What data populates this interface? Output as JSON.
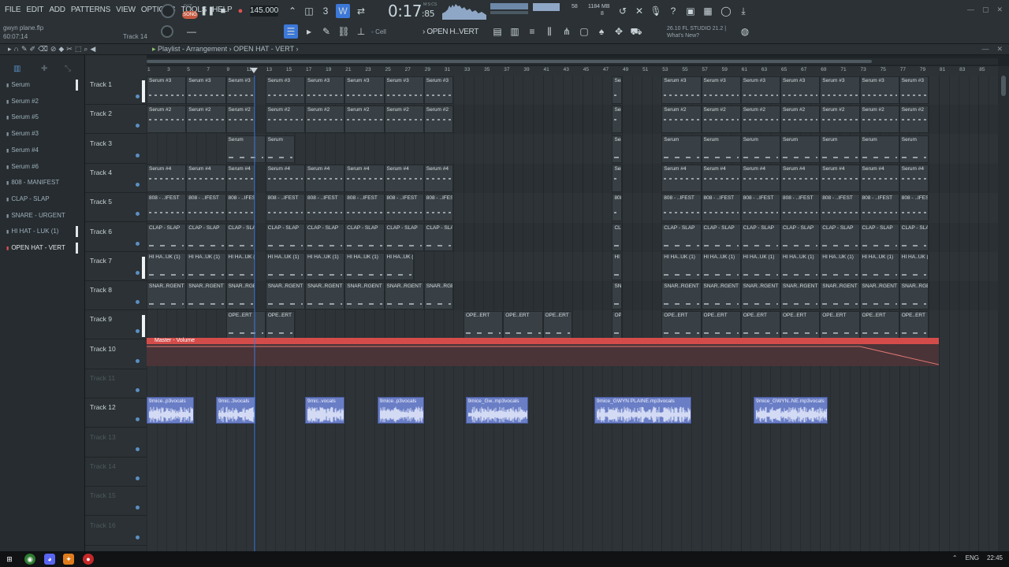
{
  "menu": [
    "FILE",
    "EDIT",
    "ADD",
    "PATTERNS",
    "VIEW",
    "OPTIONS",
    "TOOLS",
    "HELP"
  ],
  "project": {
    "name": "gwyn plane.flp",
    "time": "60:07:14",
    "track_hint": "Track 14"
  },
  "transport": {
    "pat_label": "PAT",
    "song_label": "SONG",
    "tempo": "145.000",
    "clock_main": "0:17",
    "clock_sub": ":85",
    "clock_unit": "M:S:CS"
  },
  "perf": {
    "ram": "1184 MB",
    "poly": "58",
    "poly2": "8"
  },
  "snap": {
    "label": "Cell"
  },
  "pattern_selector": {
    "name": "OPEN H..VERT"
  },
  "version": {
    "line1": "26.10 FL STUDIO 21.2 |",
    "line2": "What's New?"
  },
  "playlist": {
    "title": "Playlist - Arrangement",
    "pattern": "OPEN HAT - VERT",
    "sep": "›"
  },
  "patterns": [
    {
      "label": "Serum",
      "active": false,
      "selected": true
    },
    {
      "label": "Serum #2",
      "active": false,
      "selected": false
    },
    {
      "label": "Serum #5",
      "active": false,
      "selected": false
    },
    {
      "label": "Serum #3",
      "active": false,
      "selected": false
    },
    {
      "label": "Serum #4",
      "active": false,
      "selected": false
    },
    {
      "label": "Serum #6",
      "active": false,
      "selected": false
    },
    {
      "label": "808 - MANIFEST",
      "active": false,
      "selected": false
    },
    {
      "label": "CLAP - SLAP",
      "active": false,
      "selected": false
    },
    {
      "label": "SNARE - URGENT",
      "active": false,
      "selected": false
    },
    {
      "label": "HI HAT - LUK (1)",
      "active": false,
      "selected": true
    },
    {
      "label": "OPEN HAT - VERT",
      "active": true,
      "selected": true
    }
  ],
  "tracks": [
    {
      "name": "Track 1",
      "dim": false,
      "bar": true
    },
    {
      "name": "Track 2",
      "dim": false,
      "bar": false
    },
    {
      "name": "Track 3",
      "dim": false,
      "bar": false
    },
    {
      "name": "Track 4",
      "dim": false,
      "bar": false
    },
    {
      "name": "Track 5",
      "dim": false,
      "bar": false
    },
    {
      "name": "Track 6",
      "dim": false,
      "bar": false
    },
    {
      "name": "Track 7",
      "dim": false,
      "bar": true
    },
    {
      "name": "Track 8",
      "dim": false,
      "bar": false
    },
    {
      "name": "Track 9",
      "dim": false,
      "bar": true
    },
    {
      "name": "Track 10",
      "dim": false,
      "bar": false
    },
    {
      "name": "Track 11",
      "dim": true,
      "bar": false
    },
    {
      "name": "Track 12",
      "dim": false,
      "bar": false
    },
    {
      "name": "Track 13",
      "dim": true,
      "bar": false
    },
    {
      "name": "Track 14",
      "dim": true,
      "bar": false
    },
    {
      "name": "Track 15",
      "dim": true,
      "bar": false
    },
    {
      "name": "Track 16",
      "dim": true,
      "bar": false
    },
    {
      "name": "Track 17",
      "dim": true,
      "bar": false
    }
  ],
  "ruler_marks": [
    "1",
    "3",
    "5",
    "7",
    "9",
    "11",
    "13",
    "15",
    "17",
    "19",
    "21",
    "23",
    "25",
    "27",
    "29",
    "31",
    "33",
    "35",
    "37",
    "39",
    "41",
    "43",
    "45",
    "47",
    "49",
    "51",
    "53",
    "55",
    "57",
    "59",
    "61",
    "63",
    "65",
    "67",
    "69",
    "71",
    "73",
    "75",
    "77",
    "79",
    "81",
    "83",
    "85"
  ],
  "lanes": [
    {
      "label": "Serum #3",
      "style": "a",
      "runs": [
        [
          1,
          12
        ],
        [
          13,
          32
        ],
        [
          53,
          80
        ]
      ],
      "extra": [
        [
          48,
          49
        ]
      ]
    },
    {
      "label": "Serum #2",
      "style": "b",
      "runs": [
        [
          1,
          12
        ],
        [
          13,
          32
        ],
        [
          53,
          80
        ]
      ],
      "extra": [
        [
          48,
          49
        ]
      ]
    },
    {
      "label": "Serum",
      "style": "c",
      "runs": [
        [
          9,
          16
        ],
        [
          53,
          80
        ]
      ],
      "extra": [
        [
          48,
          49
        ]
      ]
    },
    {
      "label": "Serum #4",
      "style": "b",
      "runs": [
        [
          1,
          12
        ],
        [
          13,
          32
        ],
        [
          53,
          80
        ]
      ],
      "extra": [
        [
          48,
          49
        ]
      ]
    },
    {
      "label": "808 - ..IFEST",
      "style": "a",
      "runs": [
        [
          1,
          12
        ],
        [
          13,
          32
        ],
        [
          53,
          80
        ]
      ],
      "extra": [
        [
          48,
          49
        ]
      ]
    },
    {
      "label": "CLAP - SLAP",
      "style": "c",
      "runs": [
        [
          1,
          12
        ],
        [
          13,
          32
        ],
        [
          53,
          80
        ]
      ],
      "extra": [
        [
          48,
          49
        ]
      ]
    },
    {
      "label": "HI HA..UK (1)",
      "style": "c",
      "runs": [
        [
          1,
          12
        ],
        [
          13,
          28
        ],
        [
          53,
          80
        ]
      ],
      "extra": [
        [
          48,
          49
        ]
      ]
    },
    {
      "label": "SNAR..RGENT",
      "style": "c",
      "runs": [
        [
          1,
          12
        ],
        [
          13,
          32
        ],
        [
          53,
          80
        ]
      ],
      "extra": [
        [
          48,
          49
        ]
      ]
    },
    {
      "label": "OPE..ERT",
      "style": "c",
      "runs": [
        [
          9,
          16
        ],
        [
          33,
          44
        ],
        [
          53,
          80
        ]
      ],
      "extra": [
        [
          48,
          49
        ]
      ]
    }
  ],
  "master": {
    "label": "Master - Volume"
  },
  "audio_clips": [
    {
      "label": "9mice..p3vocals",
      "start": 1,
      "end": 5.8
    },
    {
      "label": "9mic..3vocals",
      "start": 8,
      "end": 12
    },
    {
      "label": "9mic..vocals",
      "start": 17,
      "end": 21
    },
    {
      "label": "9mice..p3vocals",
      "start": 24.3,
      "end": 29
    },
    {
      "label": "9mice_Gw..mp3vocals",
      "start": 33.2,
      "end": 39.5
    },
    {
      "label": "9mice_GWYN PLAINE.mp3vocals",
      "start": 46.2,
      "end": 56
    },
    {
      "label": "9mice_GWYN..NE.mp3vocals",
      "start": 62.3,
      "end": 69.8
    }
  ],
  "tray": {
    "lang": "ENG",
    "time": "22:45"
  },
  "taskbar_icons": [
    "windows-icon",
    "chrome-icon",
    "discord-icon",
    "fl-studio-icon",
    "record-icon"
  ],
  "colors": {
    "accent": "#c45a43",
    "master_red": "#d44c4a",
    "audio_blue": "#6a7ec6"
  }
}
